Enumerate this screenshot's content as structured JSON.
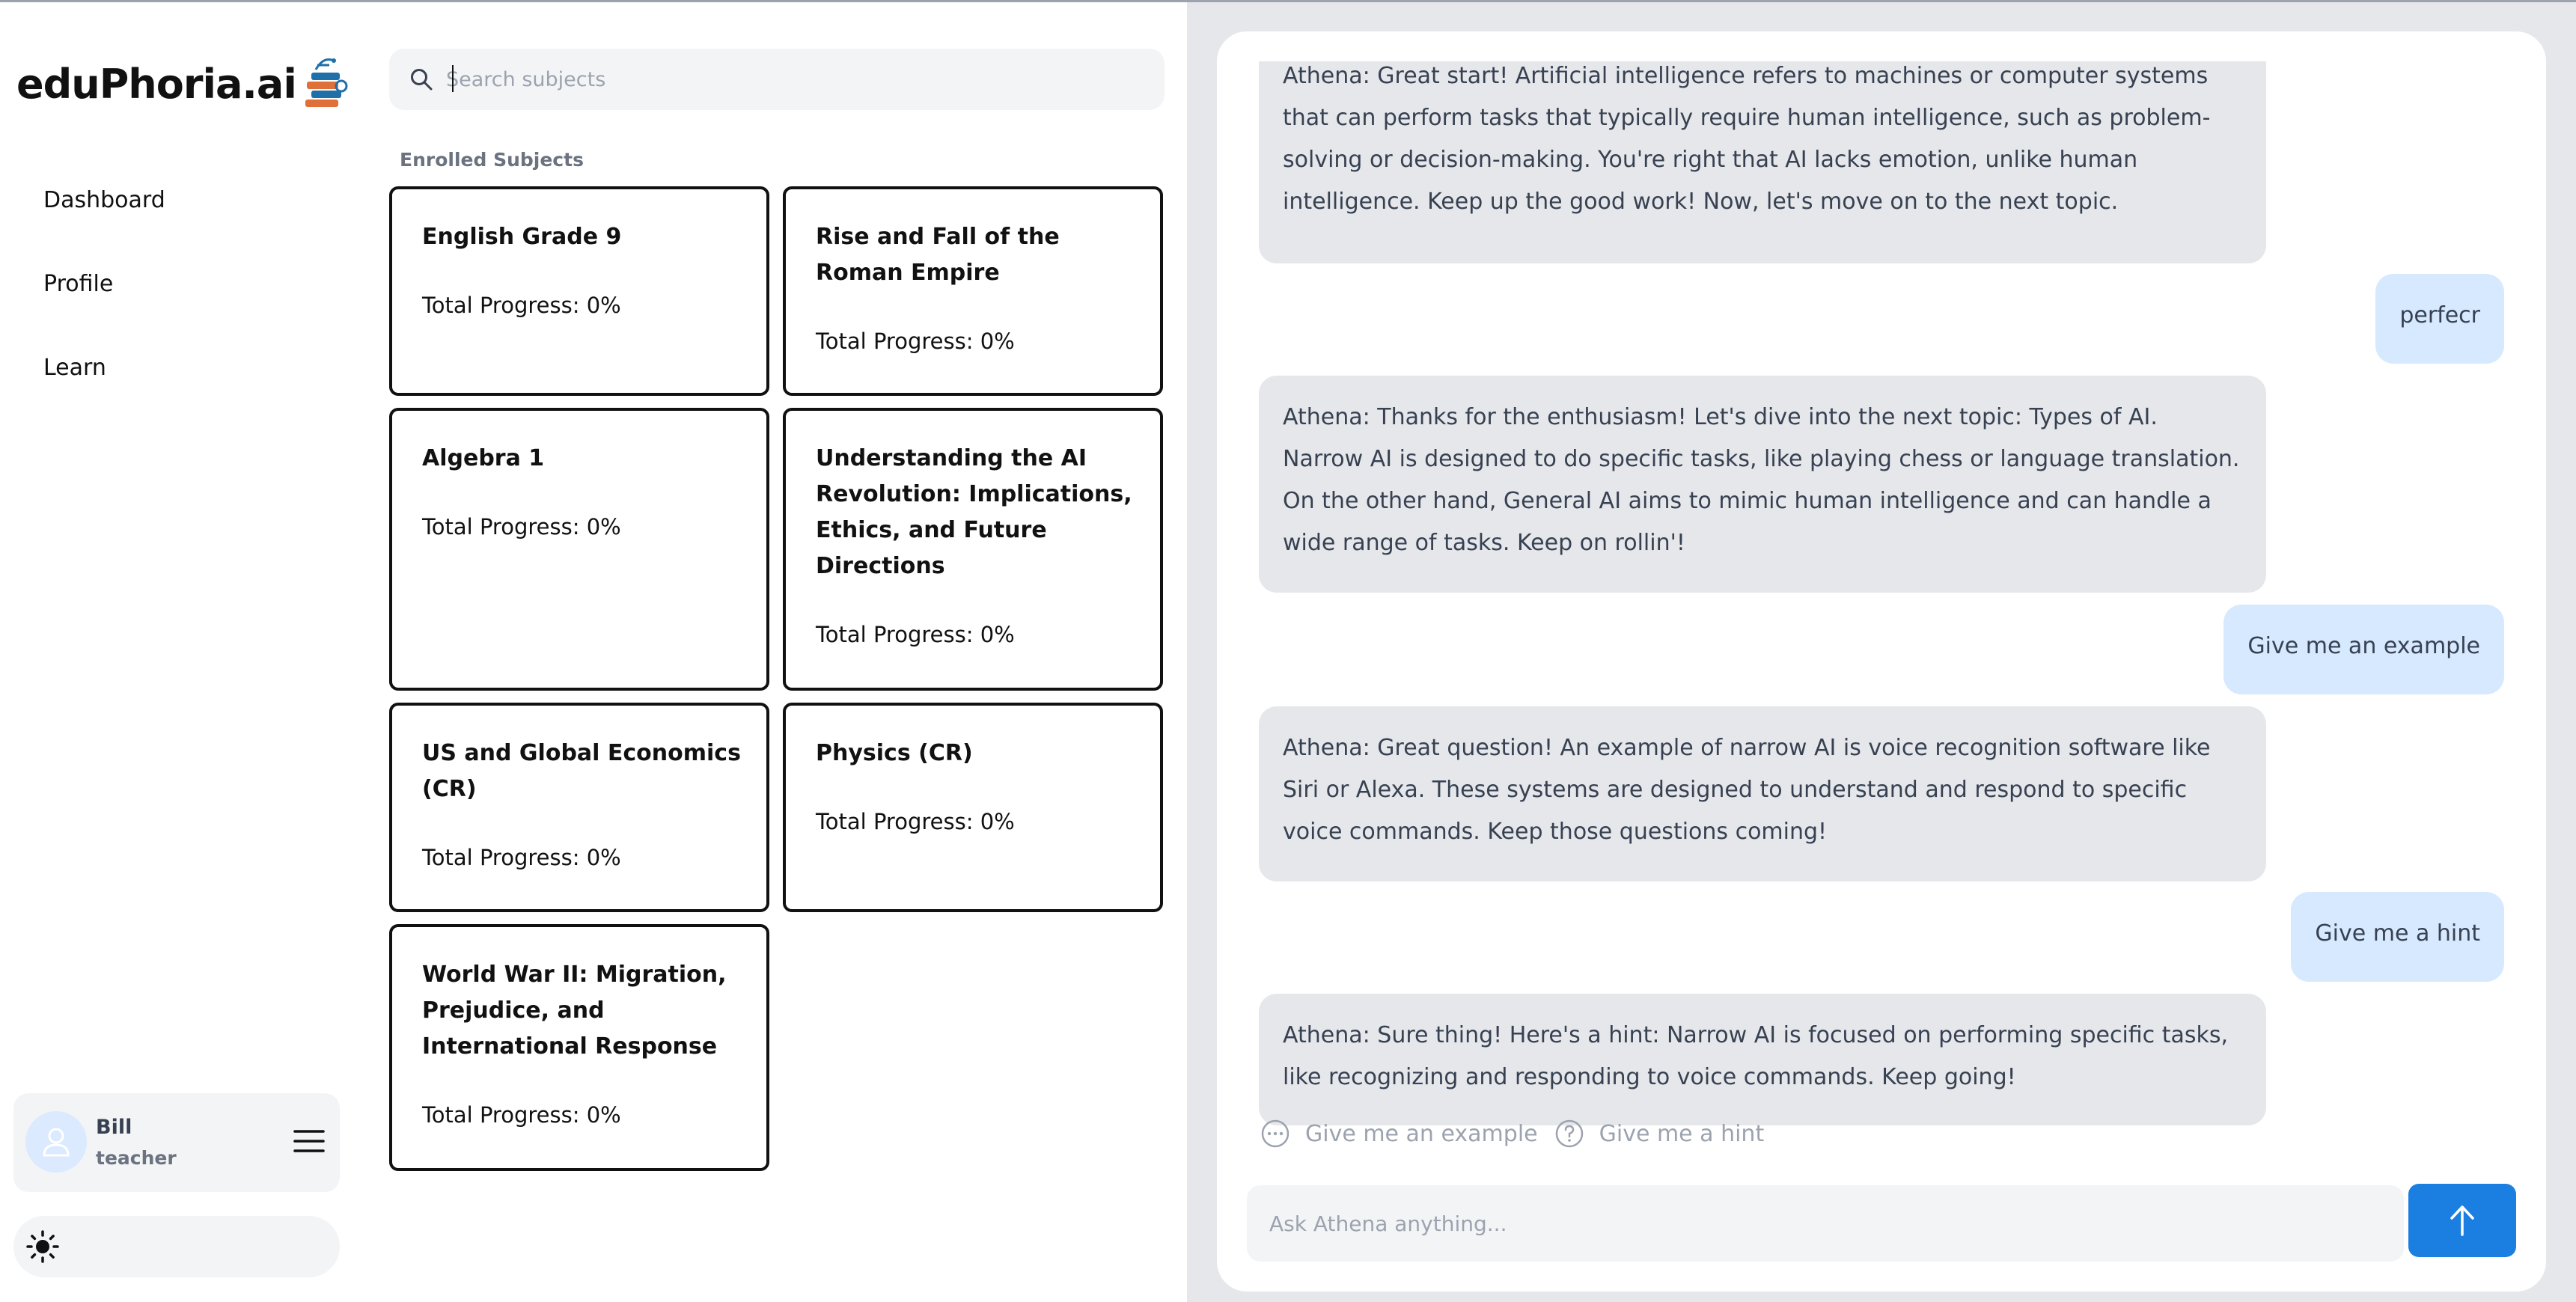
{
  "app": {
    "logo_text": "eduPhoria.ai"
  },
  "nav": {
    "items": [
      {
        "label": "Dashboard"
      },
      {
        "label": "Profile"
      },
      {
        "label": "Learn"
      }
    ]
  },
  "user": {
    "name": "Bill",
    "role": "teacher"
  },
  "search": {
    "placeholder": "Search subjects",
    "value": ""
  },
  "subjects": {
    "section_label": "Enrolled Subjects",
    "cards": [
      {
        "title": "English Grade 9",
        "progress": "Total Progress: 0%"
      },
      {
        "title": "Rise and Fall of the Roman Empire",
        "progress": "Total Progress: 0%"
      },
      {
        "title": "Algebra 1",
        "progress": "Total Progress: 0%"
      },
      {
        "title": "Understanding the AI Revolution: Implications, Ethics, and Future Directions",
        "progress": "Total Progress: 0%"
      },
      {
        "title": "US and Global Economics (CR)",
        "progress": "Total Progress: 0%"
      },
      {
        "title": "Physics (CR)",
        "progress": "Total Progress: 0%"
      },
      {
        "title": "World War II: Migration, Prejudice, and International Response",
        "progress": "Total Progress: 0%"
      }
    ]
  },
  "chat": {
    "messages": [
      {
        "role": "bot",
        "text": "Athena: Great start! Artificial intelligence refers to machines or computer systems that can perform tasks that typically require human intelligence, such as problem-solving or decision-making. You're right that AI lacks emotion, unlike human intelligence. Keep up the good work! Now, let's move on to the next topic."
      },
      {
        "role": "user",
        "text": "perfecr"
      },
      {
        "role": "bot",
        "text": "Athena: Thanks for the enthusiasm! Let's dive into the next topic: Types of AI. Narrow AI is designed to do specific tasks, like playing chess or language translation. On the other hand, General AI aims to mimic human intelligence and can handle a wide range of tasks. Keep on rollin'!"
      },
      {
        "role": "user",
        "text": "Give me an example"
      },
      {
        "role": "bot",
        "text": "Athena: Great question! An example of narrow AI is voice recognition software like Siri or Alexa. These systems are designed to understand and respond to specific voice commands. Keep those questions coming!"
      },
      {
        "role": "user",
        "text": "Give me a hint"
      },
      {
        "role": "bot",
        "text": "Athena: Sure thing! Here's a hint: Narrow AI is focused on performing specific tasks, like recognizing and responding to voice commands. Keep going!"
      }
    ],
    "suggestions": [
      {
        "label": "Give me an example",
        "icon": "ellipsis-circle-icon"
      },
      {
        "label": "Give me a hint",
        "icon": "question-circle-icon"
      }
    ],
    "input_placeholder": "Ask Athena anything...",
    "input_value": ""
  },
  "colors": {
    "accent": "#1a7fe0",
    "user_bubble": "#d6e9ff",
    "bot_bubble": "#e5e7eb"
  }
}
